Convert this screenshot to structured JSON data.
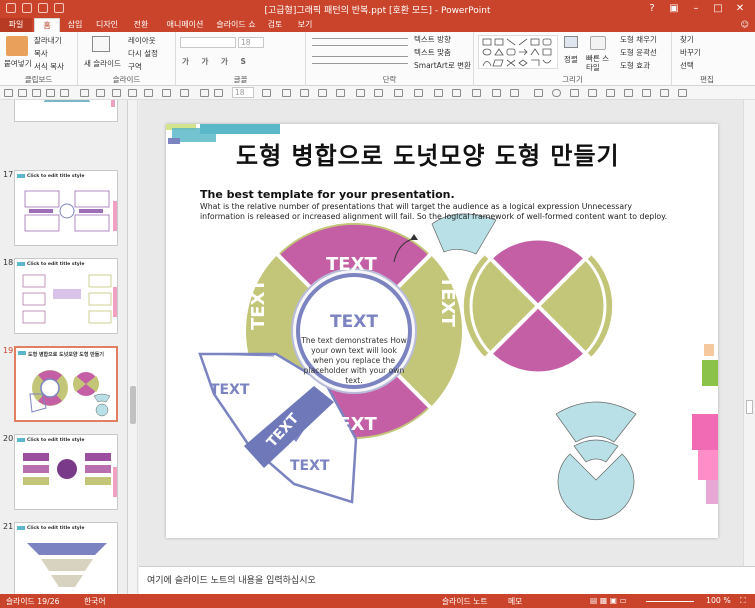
{
  "window": {
    "title": "[고급형]그래픽 패턴의 반복.ppt [호환 모드] - PowerPoint"
  },
  "tabs": {
    "file": "파일",
    "home": "홈",
    "insert": "삽입",
    "design": "디자인",
    "transitions": "전환",
    "animations": "애니메이션",
    "slideshow": "슬라이드 쇼",
    "review": "검토",
    "view": "보기"
  },
  "ribbon": {
    "clipboard": {
      "paste": "붙여넣기",
      "cut": "잘라내기",
      "copy": "복사",
      "format_painter": "서식 복사",
      "label": "클립보드"
    },
    "slides": {
      "new_slide": "새 슬라이드",
      "layout": "레이아웃",
      "reset": "다시 설정",
      "section": "구역",
      "label": "슬라이드"
    },
    "font": {
      "size": "18",
      "label": "글꼴"
    },
    "paragraph": {
      "text_direction": "텍스트 방향",
      "align_text": "텍스트 맞춤",
      "smartart": "SmartArt로 변환",
      "label": "단락"
    },
    "drawing": {
      "arrange": "정렬",
      "quick_styles": "빠른 스타일",
      "shape_fill": "도형 채우기",
      "shape_outline": "도형 윤곽선",
      "shape_effects": "도형 효과",
      "label": "그리기"
    },
    "editing": {
      "find": "찾기",
      "replace": "바꾸기",
      "select": "선택",
      "label": "편집"
    }
  },
  "toolbar2": {
    "font_size": "18"
  },
  "thumbnails": [
    {
      "num": "17",
      "title": "Click to edit title style"
    },
    {
      "num": "18",
      "title": "Click to edit title style"
    },
    {
      "num": "19",
      "title": "도형 병합으로 도넛모양 도형 만들기"
    },
    {
      "num": "20",
      "title": "Click to edit title style"
    },
    {
      "num": "21",
      "title": "Click to edit title style"
    }
  ],
  "slide": {
    "title": "도형 병합으로 도넛모양 도형 만들기",
    "subtitle": "The best template for your presentation.",
    "body": "What is the relative number of presentations that will target the audience as a logical expression Unnecessary information is released or increased alignment will fail. So the logical framework of well-formed content want to deploy.",
    "ring": {
      "top": "TEXT",
      "left": "TEXT",
      "right": "TEXT",
      "bottom": "TEXT"
    },
    "center": {
      "title": "TEXT",
      "desc": "The text demonstrates How your own text will look when you replace the placeholder with your own text."
    },
    "fan": {
      "upper": "TEXT",
      "band": "TEXT",
      "lower": "TEXT"
    },
    "colors": {
      "pink": "#c45fa5",
      "olive": "#c3c679",
      "navy": "#7b84c0",
      "lightblue": "#b8e0e6"
    }
  },
  "notes": {
    "placeholder": "여기에 슬라이드 노트의 내용을 입력하십시오"
  },
  "status": {
    "slide": "슬라이드 19/26",
    "lang": "한국어",
    "notes": "슬라이드 노트",
    "memo": "메모",
    "zoom": "100 %"
  }
}
